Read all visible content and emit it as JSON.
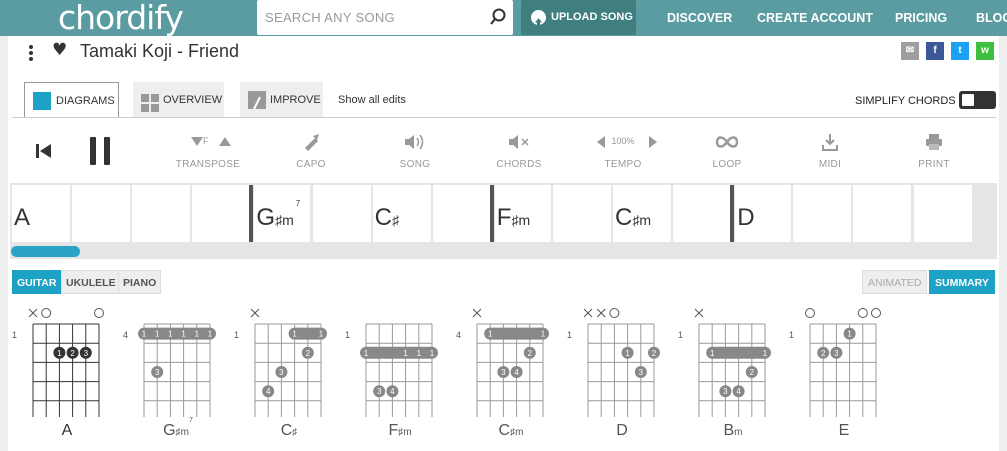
{
  "nav": {
    "logo": "chordify",
    "search_placeholder": "SEARCH ANY SONG",
    "upload_label": "UPLOAD SONG",
    "links": [
      "DISCOVER",
      "CREATE ACCOUNT",
      "PRICING",
      "BLOG"
    ]
  },
  "song": {
    "title": "Tamaki Koji - Friend"
  },
  "share": [
    {
      "icon": "email-icon",
      "color": "#9e9e9e"
    },
    {
      "icon": "facebook-icon",
      "color": "#3b5998"
    },
    {
      "icon": "twitter-icon",
      "color": "#1da1f2"
    },
    {
      "icon": "whatsapp-icon",
      "color": "#3fbf3f"
    }
  ],
  "tabs": {
    "diagrams": "DIAGRAMS",
    "overview": "OVERVIEW",
    "improve": "IMPROVE",
    "show_edits": "Show all edits",
    "simplify_label": "SIMPLIFY CHORDS",
    "simplify_on": false
  },
  "controls": {
    "transpose": "TRANSPOSE",
    "transpose_note": "F",
    "capo": "CAPO",
    "song": "SONG",
    "chords": "CHORDS",
    "tempo": "TEMPO",
    "tempo_value": "100%",
    "loop": "LOOP",
    "midi": "MIDI",
    "print": "PRINT"
  },
  "timeline": {
    "cells": [
      {
        "root": "A",
        "suffix": "",
        "sup": "",
        "bar_start": false
      },
      {
        "root": "",
        "suffix": "",
        "sup": "",
        "bar_start": false
      },
      {
        "root": "",
        "suffix": "",
        "sup": "",
        "bar_start": false
      },
      {
        "root": "",
        "suffix": "",
        "sup": "",
        "bar_start": false
      },
      {
        "root": "G",
        "suffix": "♯m",
        "sup": "7",
        "bar_start": true
      },
      {
        "root": "",
        "suffix": "",
        "sup": "",
        "bar_start": false
      },
      {
        "root": "C",
        "suffix": "♯",
        "sup": "",
        "bar_start": false
      },
      {
        "root": "",
        "suffix": "",
        "sup": "",
        "bar_start": false
      },
      {
        "root": "F",
        "suffix": "♯m",
        "sup": "",
        "bar_start": true
      },
      {
        "root": "",
        "suffix": "",
        "sup": "",
        "bar_start": false
      },
      {
        "root": "C",
        "suffix": "♯m",
        "sup": "",
        "bar_start": false
      },
      {
        "root": "",
        "suffix": "",
        "sup": "",
        "bar_start": false
      },
      {
        "root": "D",
        "suffix": "",
        "sup": "",
        "bar_start": true
      },
      {
        "root": "",
        "suffix": "",
        "sup": "",
        "bar_start": false
      },
      {
        "root": "",
        "suffix": "",
        "sup": "",
        "bar_start": false
      },
      {
        "root": "",
        "suffix": "",
        "sup": "",
        "bar_start": false
      }
    ],
    "progress": 0.07
  },
  "instruments": {
    "options": [
      "GUITAR",
      "UKULELE",
      "PIANO"
    ],
    "selected": "GUITAR",
    "views": [
      "ANIMATED",
      "SUMMARY"
    ],
    "selected_view": "SUMMARY",
    "accent": "#1ba2c4"
  },
  "diagrams": [
    {
      "root": "A",
      "suffix": "",
      "sup": "",
      "fret": "1",
      "active": true,
      "open": [
        "x",
        "o",
        "",
        "",
        "",
        "o"
      ],
      "barre": null,
      "dots": [
        {
          "s": 2,
          "f": 2,
          "n": "1"
        },
        {
          "s": 3,
          "f": 2,
          "n": "2"
        },
        {
          "s": 4,
          "f": 2,
          "n": "3"
        }
      ]
    },
    {
      "root": "G",
      "suffix": "♯m",
      "sup": "7",
      "fret": "4",
      "active": false,
      "open": [
        "",
        "",
        "",
        "",
        "",
        ""
      ],
      "barre": {
        "f": 1,
        "from": 0,
        "to": 5,
        "labels": [
          "1",
          "1",
          "1",
          "1",
          "1",
          "1"
        ]
      },
      "dots": [
        {
          "s": 1,
          "f": 3,
          "n": "3"
        }
      ]
    },
    {
      "root": "C",
      "suffix": "♯",
      "sup": "",
      "fret": "1",
      "active": false,
      "open": [
        "x",
        "",
        "",
        "",
        "",
        ""
      ],
      "barre": {
        "f": 1,
        "from": 3,
        "to": 5,
        "labels": [
          "1",
          "",
          "1"
        ]
      },
      "dots": [
        {
          "s": 4,
          "f": 2,
          "n": "2"
        },
        {
          "s": 2,
          "f": 3,
          "n": "3"
        },
        {
          "s": 1,
          "f": 4,
          "n": "4"
        }
      ]
    },
    {
      "root": "F",
      "suffix": "♯m",
      "sup": "",
      "fret": "1",
      "active": false,
      "open": [
        "",
        "",
        "",
        "",
        "",
        ""
      ],
      "barre": {
        "f": 2,
        "from": 0,
        "to": 5,
        "labels": [
          "1",
          "",
          "",
          "1",
          "1",
          "1"
        ]
      },
      "dots": [
        {
          "s": 1,
          "f": 4,
          "n": "3"
        },
        {
          "s": 2,
          "f": 4,
          "n": "4"
        }
      ]
    },
    {
      "root": "C",
      "suffix": "♯m",
      "sup": "",
      "fret": "4",
      "active": false,
      "open": [
        "x",
        "",
        "",
        "",
        "",
        ""
      ],
      "barre": {
        "f": 1,
        "from": 1,
        "to": 5,
        "labels": [
          "1",
          "",
          "",
          "",
          "1"
        ]
      },
      "dots": [
        {
          "s": 4,
          "f": 2,
          "n": "2"
        },
        {
          "s": 2,
          "f": 3,
          "n": "3"
        },
        {
          "s": 3,
          "f": 3,
          "n": "4"
        }
      ]
    },
    {
      "root": "D",
      "suffix": "",
      "sup": "",
      "fret": "1",
      "active": false,
      "open": [
        "x",
        "x",
        "o",
        "",
        "",
        ""
      ],
      "barre": null,
      "dots": [
        {
          "s": 3,
          "f": 2,
          "n": "1"
        },
        {
          "s": 5,
          "f": 2,
          "n": "2"
        },
        {
          "s": 4,
          "f": 3,
          "n": "3"
        }
      ]
    },
    {
      "root": "B",
      "suffix": "m",
      "sup": "",
      "fret": "1",
      "active": false,
      "open": [
        "x",
        "",
        "",
        "",
        "",
        ""
      ],
      "barre": {
        "f": 2,
        "from": 1,
        "to": 5,
        "labels": [
          "1",
          "",
          "",
          "",
          "1"
        ]
      },
      "dots": [
        {
          "s": 4,
          "f": 3,
          "n": "2"
        },
        {
          "s": 2,
          "f": 4,
          "n": "3"
        },
        {
          "s": 3,
          "f": 4,
          "n": "4"
        }
      ]
    },
    {
      "root": "E",
      "suffix": "",
      "sup": "",
      "fret": "1",
      "active": false,
      "open": [
        "o",
        "",
        "",
        "",
        "o",
        "o"
      ],
      "barre": null,
      "dots": [
        {
          "s": 3,
          "f": 1,
          "n": "1"
        },
        {
          "s": 1,
          "f": 2,
          "n": "2"
        },
        {
          "s": 2,
          "f": 2,
          "n": "3"
        }
      ]
    }
  ]
}
